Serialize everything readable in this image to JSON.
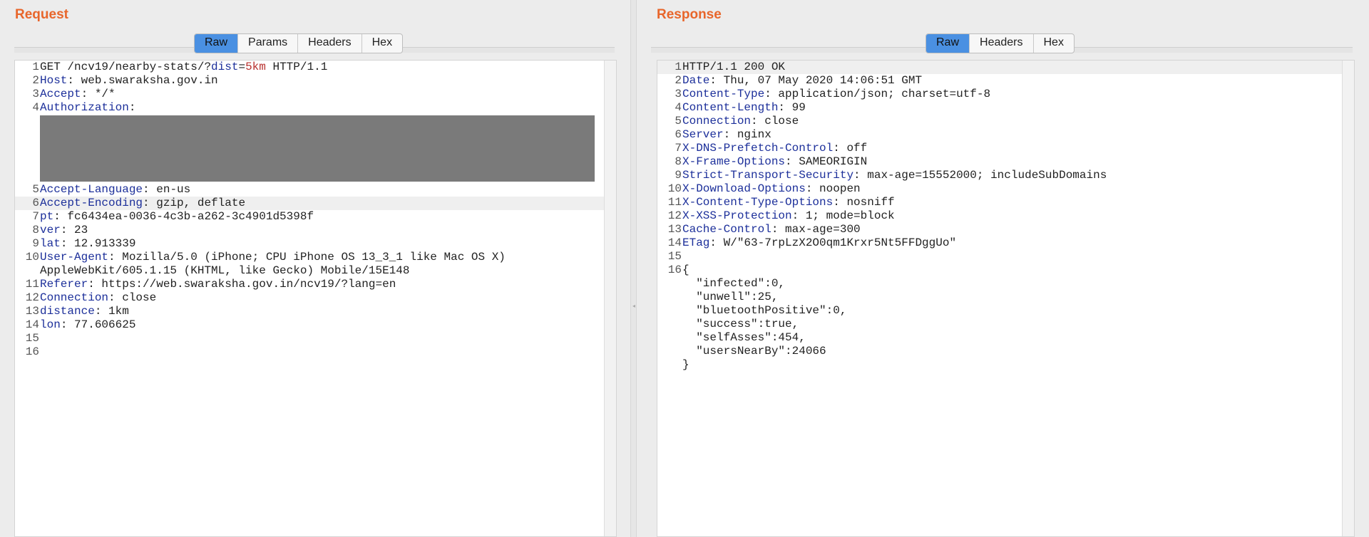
{
  "request": {
    "title": "Request",
    "tabs": [
      "Raw",
      "Params",
      "Headers",
      "Hex"
    ],
    "active_tab": "Raw",
    "lines": [
      {
        "num": "1",
        "parts": [
          {
            "t": "GET /ncv19/nearby-stats/?"
          },
          {
            "t": "dist",
            "c": "pname"
          },
          {
            "t": "="
          },
          {
            "t": "5km",
            "c": "pval"
          },
          {
            "t": " HTTP/1.1"
          }
        ]
      },
      {
        "num": "2",
        "parts": [
          {
            "t": "Host",
            "c": "k"
          },
          {
            "t": ": web.swaraksha.gov.in"
          }
        ]
      },
      {
        "num": "3",
        "parts": [
          {
            "t": "Accept",
            "c": "k"
          },
          {
            "t": ": */*"
          }
        ]
      },
      {
        "num": "4",
        "parts": [
          {
            "t": "Authorization",
            "c": "k"
          },
          {
            "t": ":"
          }
        ]
      },
      {
        "num": "5",
        "parts": [
          {
            "t": "Accept-Language",
            "c": "k"
          },
          {
            "t": ": en-us"
          }
        ]
      },
      {
        "num": "6",
        "parts": [
          {
            "t": "Accept-Encoding",
            "c": "k"
          },
          {
            "t": ": gzip, deflate"
          }
        ],
        "hl": true
      },
      {
        "num": "7",
        "parts": [
          {
            "t": "pt",
            "c": "k"
          },
          {
            "t": ": fc6434ea-0036-4c3b-a262-3c4901d5398f"
          }
        ]
      },
      {
        "num": "8",
        "parts": [
          {
            "t": "ver",
            "c": "k"
          },
          {
            "t": ": 23"
          }
        ]
      },
      {
        "num": "9",
        "parts": [
          {
            "t": "lat",
            "c": "k"
          },
          {
            "t": ": 12.913339"
          }
        ]
      },
      {
        "num": "10",
        "parts": [
          {
            "t": "User-Agent",
            "c": "k"
          },
          {
            "t": ": Mozilla/5.0 (iPhone; CPU iPhone OS 13_3_1 like Mac OS X)"
          }
        ]
      },
      {
        "num": "",
        "parts": [
          {
            "t": "AppleWebKit/605.1.15 (KHTML, like Gecko) Mobile/15E148"
          }
        ]
      },
      {
        "num": "11",
        "parts": [
          {
            "t": "Referer",
            "c": "k"
          },
          {
            "t": ": https://web.swaraksha.gov.in/ncv19/?lang=en"
          }
        ]
      },
      {
        "num": "12",
        "parts": [
          {
            "t": "Connection",
            "c": "k"
          },
          {
            "t": ": close"
          }
        ]
      },
      {
        "num": "13",
        "parts": [
          {
            "t": "distance",
            "c": "k"
          },
          {
            "t": ": 1km"
          }
        ]
      },
      {
        "num": "14",
        "parts": [
          {
            "t": "lon",
            "c": "k"
          },
          {
            "t": ": 77.606625"
          }
        ]
      },
      {
        "num": "15",
        "parts": []
      },
      {
        "num": "16",
        "parts": []
      }
    ]
  },
  "response": {
    "title": "Response",
    "tabs": [
      "Raw",
      "Headers",
      "Hex"
    ],
    "active_tab": "Raw",
    "lines": [
      {
        "num": "1",
        "parts": [
          {
            "t": "HTTP/1.1 200 OK"
          }
        ],
        "hl": true
      },
      {
        "num": "2",
        "parts": [
          {
            "t": "Date",
            "c": "k"
          },
          {
            "t": ": Thu, 07 May 2020 14:06:51 GMT"
          }
        ]
      },
      {
        "num": "3",
        "parts": [
          {
            "t": "Content-Type",
            "c": "k"
          },
          {
            "t": ": application/json; charset=utf-8"
          }
        ]
      },
      {
        "num": "4",
        "parts": [
          {
            "t": "Content-Length",
            "c": "k"
          },
          {
            "t": ": 99"
          }
        ]
      },
      {
        "num": "5",
        "parts": [
          {
            "t": "Connection",
            "c": "k"
          },
          {
            "t": ": close"
          }
        ]
      },
      {
        "num": "6",
        "parts": [
          {
            "t": "Server",
            "c": "k"
          },
          {
            "t": ": nginx"
          }
        ]
      },
      {
        "num": "7",
        "parts": [
          {
            "t": "X-DNS-Prefetch-Control",
            "c": "k"
          },
          {
            "t": ": off"
          }
        ]
      },
      {
        "num": "8",
        "parts": [
          {
            "t": "X-Frame-Options",
            "c": "k"
          },
          {
            "t": ": SAMEORIGIN"
          }
        ]
      },
      {
        "num": "9",
        "parts": [
          {
            "t": "Strict-Transport-Security",
            "c": "k"
          },
          {
            "t": ": max-age=15552000; includeSubDomains"
          }
        ]
      },
      {
        "num": "10",
        "parts": [
          {
            "t": "X-Download-Options",
            "c": "k"
          },
          {
            "t": ": noopen"
          }
        ]
      },
      {
        "num": "11",
        "parts": [
          {
            "t": "X-Content-Type-Options",
            "c": "k"
          },
          {
            "t": ": nosniff"
          }
        ]
      },
      {
        "num": "12",
        "parts": [
          {
            "t": "X-XSS-Protection",
            "c": "k"
          },
          {
            "t": ": 1; mode=block"
          }
        ]
      },
      {
        "num": "13",
        "parts": [
          {
            "t": "Cache-Control",
            "c": "k"
          },
          {
            "t": ": max-age=300"
          }
        ]
      },
      {
        "num": "14",
        "parts": [
          {
            "t": "ETag",
            "c": "k"
          },
          {
            "t": ": W/\"63-7rpLzX2O0qm1Krxr5Nt5FFDggUo\""
          }
        ]
      },
      {
        "num": "15",
        "parts": []
      },
      {
        "num": "16",
        "parts": [
          {
            "t": "{"
          }
        ]
      },
      {
        "num": "",
        "parts": [
          {
            "t": "  \"infected\":0,"
          }
        ]
      },
      {
        "num": "",
        "parts": [
          {
            "t": "  \"unwell\":25,"
          }
        ]
      },
      {
        "num": "",
        "parts": [
          {
            "t": "  \"bluetoothPositive\":0,"
          }
        ]
      },
      {
        "num": "",
        "parts": [
          {
            "t": "  \"success\":true,"
          }
        ]
      },
      {
        "num": "",
        "parts": [
          {
            "t": "  \"selfAsses\":454,"
          }
        ]
      },
      {
        "num": "",
        "parts": [
          {
            "t": "  \"usersNearBy\":24066"
          }
        ]
      },
      {
        "num": "",
        "parts": [
          {
            "t": "}"
          }
        ]
      }
    ]
  }
}
